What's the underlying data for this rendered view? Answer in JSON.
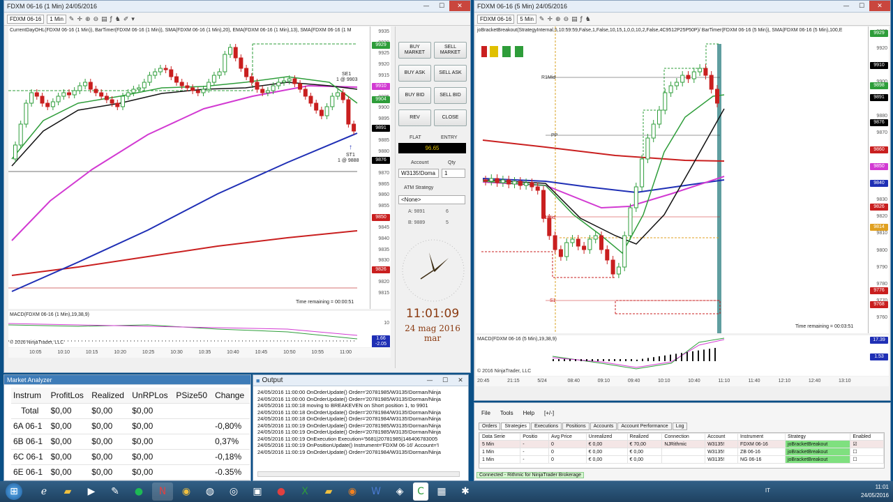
{
  "left_chart": {
    "title": "FDXM 06-16 (1 Min)  24/05/2016",
    "instrument": "FDXM 06-16",
    "interval": "1 Min",
    "indicators": "CurrentDayOHL(FDXM 06-16 (1 Min)), BarTimer(FDXM 06-16 (1 Min)), SMA(FDXM 06-16 (1 Min),20), EMA(FDXM 06-16 (1 Min),13), SMA(FDXM 06-16 (1 M",
    "price_labels": [
      "9935",
      "9930",
      "9925",
      "9920",
      "9915",
      "9910",
      "9905",
      "9900",
      "9895",
      "9890",
      "9885",
      "9880",
      "9875",
      "9870",
      "9865",
      "9860",
      "9855",
      "9850",
      "9845",
      "9840",
      "9835",
      "9830",
      "9825",
      "9820",
      "9815"
    ],
    "badges": [
      {
        "text": "9929",
        "color": "#2e9d3a"
      },
      {
        "text": "9910",
        "color": "#d23ad2"
      },
      {
        "text": "9904",
        "color": "#2e9d3a"
      },
      {
        "text": "9891",
        "color": "#000000"
      },
      {
        "text": "9876",
        "color": "#000000"
      },
      {
        "text": "9850",
        "color": "#c91f1f"
      },
      {
        "text": "9826",
        "color": "#c91f1f"
      }
    ],
    "se_label": "SE1",
    "se_price": "1 @ 9903",
    "st_label": "ST1",
    "st_price": "1 @ 9888",
    "time_remaining": "Time remaining = 00:00:51",
    "macd_label": "MACD(FDXM 06-16 (1 Min),19,38,9)",
    "macd_axis": "10",
    "macd_badge1": "1.66",
    "macd_badge2": "-2.05",
    "copyright": "© 2016 NinjaTrader, LLC",
    "time_labels": [
      "10:05",
      "10:10",
      "10:15",
      "10:20",
      "10:25",
      "10:30",
      "10:35",
      "10:40",
      "10:45",
      "10:50",
      "10:55",
      "11:00"
    ]
  },
  "chart_trader": {
    "buy_market": "BUY MARKET",
    "sell_market": "SELL MARKET",
    "buy_ask": "BUY ASK",
    "sell_ask": "SELL ASK",
    "buy_bid": "BUY BID",
    "sell_bid": "SELL BID",
    "rev": "REV",
    "close": "CLOSE",
    "flat": "FLAT",
    "entry": "ENTRY",
    "pnl": "96.65",
    "account_label": "Account",
    "qty_label": "Qty",
    "account_value": "W3135!Doma",
    "qty_value": "1",
    "atm_label": "ATM Strategy",
    "atm_value": "<None>",
    "ask": "A: 9891",
    "ask_size": "6",
    "bid": "B: 9889",
    "bid_size": "5",
    "clock_time": "11:01:09",
    "clock_date": "24 mag 2016 mar"
  },
  "right_chart": {
    "title": "FDXM 06-16 (5 Min)  24/05/2016",
    "instrument": "FDXM 06-16",
    "interval": "5 Min",
    "indicators": "joBracketBreakout(StrategyInternal,5,10:59:59,False,1,False,10,15,1,0,0,10,2,False,4C9512P25P50P)/ BarTimer(FDXM 06-16 (5 Min)), SMA(FDXM 06-16 (5 Min),100,E",
    "price_labels": [
      "9930",
      "9920",
      "9910",
      "9900",
      "9890",
      "9880",
      "9870",
      "9860",
      "9850",
      "9840",
      "9830",
      "9820",
      "9810",
      "9800",
      "9790",
      "9780",
      "9770",
      "9760"
    ],
    "badges": [
      {
        "text": "9929",
        "color": "#2e9d3a"
      },
      {
        "text": "9910",
        "color": "#000000"
      },
      {
        "text": "9898",
        "color": "#2e9d3a"
      },
      {
        "text": "9891",
        "color": "#000000"
      },
      {
        "text": "9876",
        "color": "#000000"
      },
      {
        "text": "9860",
        "color": "#c91f1f"
      },
      {
        "text": "9850",
        "color": "#d23ad2"
      },
      {
        "text": "9840",
        "color": "#1f2fb5"
      },
      {
        "text": "9826",
        "color": "#c91f1f"
      },
      {
        "text": "9814",
        "color": "#e0a020"
      },
      {
        "text": "9776",
        "color": "#c91f1f"
      },
      {
        "text": "9768",
        "color": "#c91f1f"
      }
    ],
    "r1_label": "R1Mid",
    "pp_label": "PP",
    "s1mid_label": "S1Mid",
    "s1_label": "S1",
    "time_remaining": "Time remaining = 00:03:51",
    "macd_label": "MACD(FDXM 06-16 (5 Min),19,38,9)",
    "macd_badge1": "17.39",
    "macd_badge2": "1.53",
    "copyright": "© 2016 NinjaTrader, LLC",
    "time_labels": [
      "20:45",
      "21:15",
      "5/24",
      "08:40",
      "09:10",
      "09:40",
      "10:10",
      "10:40",
      "11:10",
      "11:40",
      "12:10",
      "12:40",
      "13:10"
    ]
  },
  "market_analyzer": {
    "title": "Market Analyzer",
    "columns": [
      "Instrum",
      "ProfitLos",
      "Realized",
      "UnRPLos",
      "PSize50",
      "Change"
    ],
    "rows": [
      [
        "Total",
        "$0,00",
        "$0,00",
        "$0,00",
        "",
        ""
      ],
      [
        "6A 06-1",
        "$0,00",
        "$0,00",
        "$0,00",
        "",
        "-0,80%"
      ],
      [
        "6B 06-1",
        "$0,00",
        "$0,00",
        "$0,00",
        "",
        "0,37%"
      ],
      [
        "6C 06-1",
        "$0,00",
        "$0,00",
        "$0,00",
        "",
        "-0,18%"
      ],
      [
        "6E 06-1",
        "$0,00",
        "$0,00",
        "$0,00",
        "",
        "-0.35%"
      ]
    ]
  },
  "output": {
    "title": "Output",
    "lines": [
      "24/05/2016 11:00:00 OnOrderUpdate() Order='20781985/W3135!Dorman/Ninja",
      "24/05/2016 11:00:00 OnOrderUpdate() Order='20781985/W3135!Dorman/Ninja",
      "24/05/2016 11:00:18 moving to BREAKEVEN on Short position 1, to 9901",
      "24/05/2016 11:00:18 OnOrderUpdate() Order='20781984/W3135!Dorman/Ninja",
      "24/05/2016 11:00:18 OnOrderUpdate() Order='20781984/W3135!Dorman/Ninja",
      "24/05/2016 11:00:19 OnOrderUpdate() Order='20781985/W3135!Dorman/Ninja",
      "24/05/2016 11:00:19 OnOrderUpdate() Order='20781985/W3135!Dorman/Ninja",
      "24/05/2016 11:00:19 OnExecution Execution='5681|20781985|146406783005",
      "24/05/2016 11:00:19 OnPositionUpdate() Instrument='FDXM 06-16' Account='I",
      "24/05/2016 11:00:19 OnOrderUpdate() Order='20781984/W3135!Dorman/Ninja"
    ]
  },
  "control_center": {
    "menu": [
      "File",
      "Tools",
      "Help",
      "[+/-]"
    ],
    "tabs": [
      "Orders",
      "Strategies",
      "Executions",
      "Positions",
      "Accounts",
      "Account Performance",
      "Log"
    ],
    "columns": [
      "Data Serie",
      "Positio",
      "Avg Price",
      "Unrealized",
      "Realized",
      "Connection",
      "Account",
      "Instrument",
      "Strategy",
      "Enabled"
    ],
    "rows": [
      [
        "5 Min",
        "-",
        "0",
        "€ 0,00",
        "€ 70,00",
        "NJRithmic",
        "W3135!",
        "FDXM 06-16",
        "joBracketBreakout",
        "☑"
      ],
      [
        "1 Min",
        "-",
        "0",
        "€ 0,00",
        "€ 0,00",
        "",
        "W3135!",
        "ZB 06-16",
        "joBracketBreakout",
        "☐"
      ],
      [
        "1 Min",
        "-",
        "0",
        "€ 0,00",
        "€ 0,00",
        "",
        "W3135!",
        "NG 06-16",
        "joBracketBreakout",
        "☐"
      ]
    ],
    "status": "Connected - Rithmic for NinjaTrader Brokerage"
  },
  "taskbar": {
    "lang": "IT",
    "time": "11:01",
    "date": "24/05/2016"
  }
}
